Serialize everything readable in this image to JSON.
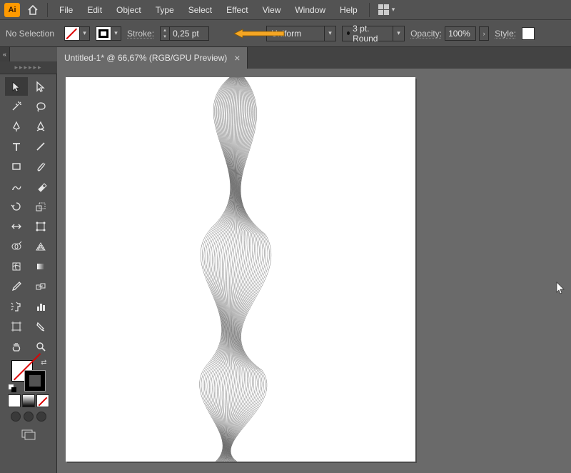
{
  "menubar": {
    "app_label": "Ai",
    "items": [
      "File",
      "Edit",
      "Object",
      "Type",
      "Select",
      "Effect",
      "View",
      "Window",
      "Help"
    ]
  },
  "controlbar": {
    "no_selection": "No Selection",
    "stroke_label": "Stroke:",
    "stroke_value": "0,25 pt",
    "profile_value": "Uniform",
    "brush_value": "3 pt. Round",
    "opacity_label": "Opacity:",
    "opacity_value": "100%",
    "style_label": "Style:"
  },
  "tab": {
    "title": "Untitled-1* @ 66,67% (RGB/GPU Preview)"
  }
}
